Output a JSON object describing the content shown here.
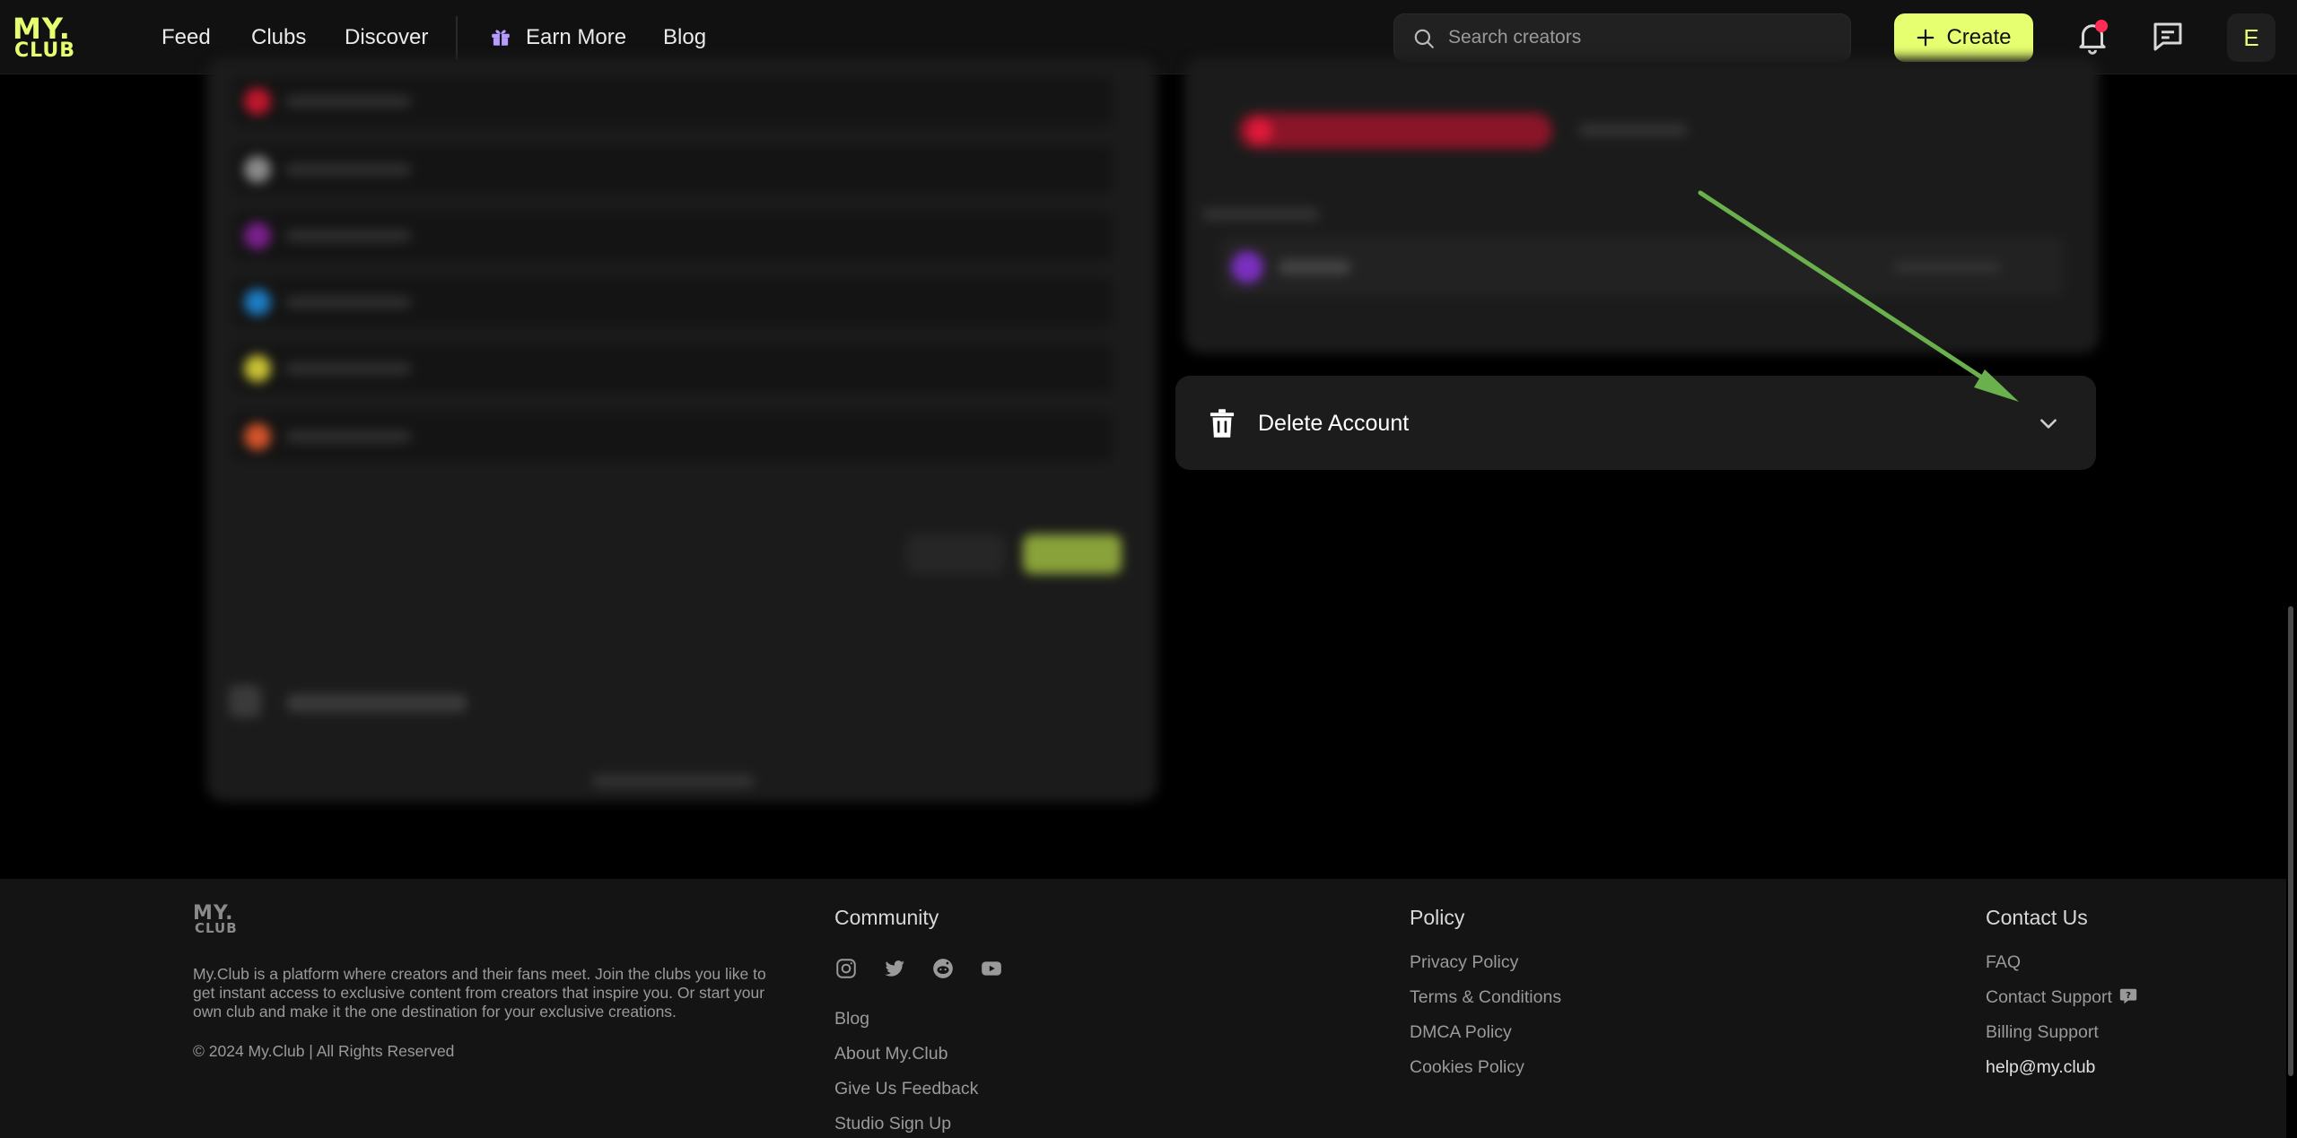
{
  "nav": {
    "logo_top": "MY.",
    "logo_bottom": "CLUB",
    "links": [
      "Feed",
      "Clubs",
      "Discover"
    ],
    "earn_more": "Earn More",
    "blog": "Blog",
    "search_placeholder": "Search creators",
    "create_label": "Create",
    "avatar_initial": "E"
  },
  "settings": {
    "delete_account_label": "Delete Account"
  },
  "footer": {
    "logo_top": "MY.",
    "logo_bottom": "CLUB",
    "about": "My.Club is a platform where creators and their fans meet. Join the clubs you like to get instant access to exclusive content from creators that inspire you. Or start your own club and make it the one destination for your exclusive creations.",
    "copyright": "© 2024 My.Club | All Rights Reserved",
    "community_heading": "Community",
    "community_links": [
      "Blog",
      "About My.Club",
      "Give Us Feedback",
      "Studio Sign Up"
    ],
    "policy_heading": "Policy",
    "policy_links": [
      "Privacy Policy",
      "Terms & Conditions",
      "DMCA Policy",
      "Cookies Policy"
    ],
    "contact_heading": "Contact Us",
    "contact_links": [
      "FAQ",
      "Contact Support",
      "Billing Support"
    ],
    "contact_email": "help@my.club",
    "social_icons": [
      "instagram-icon",
      "twitter-icon",
      "reddit-icon",
      "youtube-icon"
    ]
  },
  "colors": {
    "accent": "#e6ff70",
    "notification": "#ff2d55",
    "annotation_arrow": "#6ab04c",
    "background": "#000000",
    "card": "#1c1c1c"
  }
}
